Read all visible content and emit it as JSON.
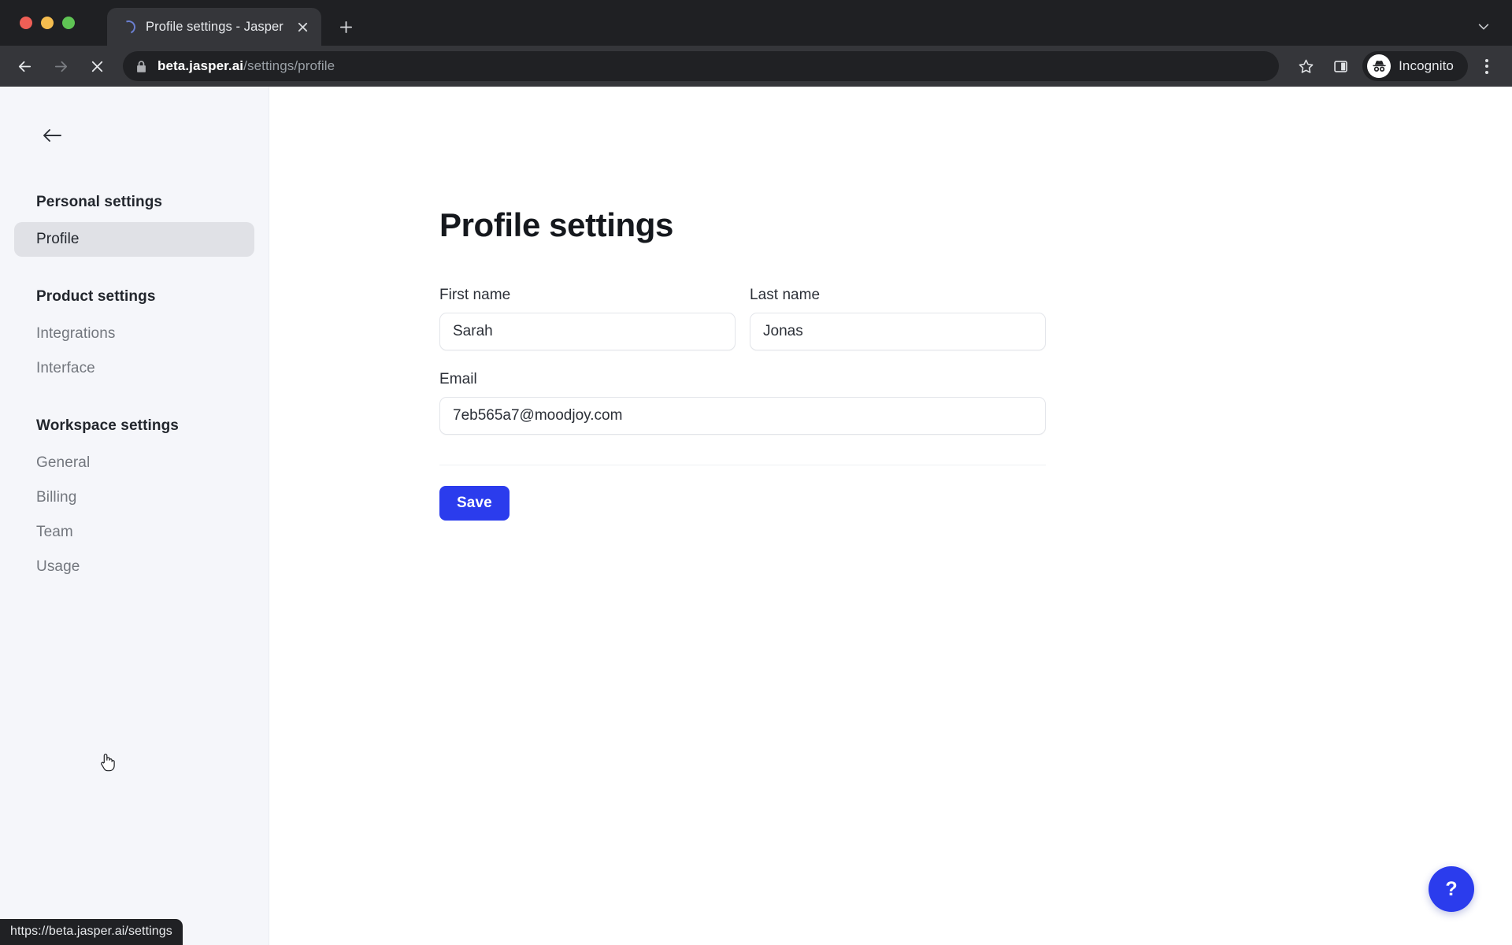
{
  "browser": {
    "tab": {
      "title": "Profile settings - Jasper",
      "favicon": "loading-spinner-icon",
      "close_icon": "close-icon"
    },
    "new_tab_icon": "plus-icon",
    "tab_list_icon": "chevron-down-icon",
    "nav": {
      "back_icon": "back-arrow-icon",
      "forward_icon": "forward-arrow-icon",
      "stop_icon": "stop-loading-icon"
    },
    "omnibox": {
      "lock_icon": "lock-icon",
      "host": "beta.jasper.ai",
      "path": "/settings/profile",
      "full_url": "beta.jasper.ai/settings/profile"
    },
    "actions": {
      "bookmark_icon": "star-icon",
      "side_panel_icon": "side-panel-icon",
      "profile_icon": "incognito-avatar-icon",
      "profile_label": "Incognito",
      "menu_icon": "three-dot-menu-icon"
    },
    "status_bar": {
      "url": "https://beta.jasper.ai/settings"
    }
  },
  "sidebar": {
    "back_icon": "back-arrow-icon",
    "groups": [
      {
        "heading": "Personal settings",
        "items": [
          {
            "label": "Profile",
            "active": true
          }
        ]
      },
      {
        "heading": "Product settings",
        "items": [
          {
            "label": "Integrations",
            "active": false
          },
          {
            "label": "Interface",
            "active": false
          }
        ]
      },
      {
        "heading": "Workspace settings",
        "items": [
          {
            "label": "General",
            "active": false
          },
          {
            "label": "Billing",
            "active": false
          },
          {
            "label": "Team",
            "active": false
          },
          {
            "label": "Usage",
            "active": false
          }
        ]
      }
    ]
  },
  "main": {
    "title": "Profile settings",
    "fields": {
      "first_name": {
        "label": "First name",
        "value": "Sarah",
        "placeholder": "First name"
      },
      "last_name": {
        "label": "Last name",
        "value": "Jonas",
        "placeholder": "Last name"
      },
      "email": {
        "label": "Email",
        "value": "7eb565a7@moodjoy.com",
        "placeholder": "Email"
      }
    },
    "save_label": "Save",
    "help_label": "?"
  },
  "colors": {
    "accent": "#2b3ced",
    "sidebar_bg": "#f5f6fa",
    "sidebar_active_bg": "#e0e1e6",
    "chrome_bg": "#35363a",
    "chrome_dark": "#202124",
    "text_dark": "#22262d",
    "text_muted": "#73777e"
  }
}
